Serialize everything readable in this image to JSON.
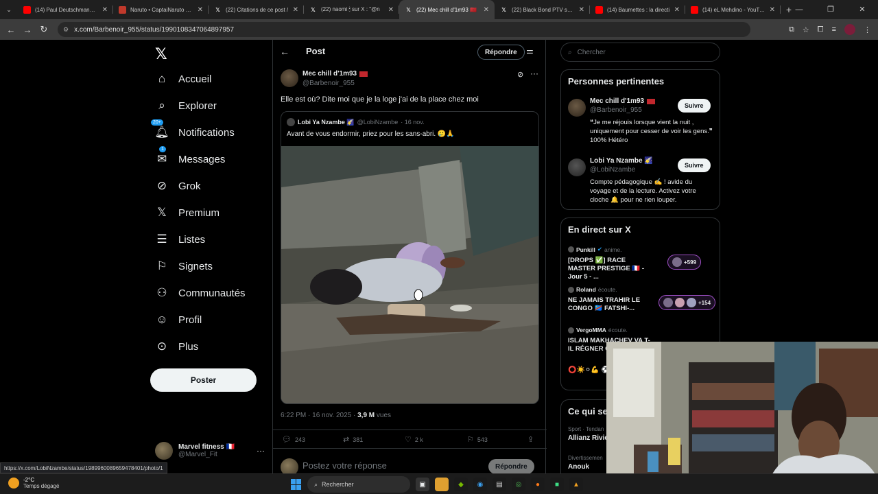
{
  "browser": {
    "tabs": [
      {
        "title": "(14) Paul Deutschmann : l",
        "favicon": "youtube-icon",
        "color": "#ff0000",
        "active": false
      },
      {
        "title": "Naruto • CaptaiNaruto », I",
        "favicon": "naruto-icon",
        "color": "#c0392b",
        "active": false
      },
      {
        "title": "(22) Citations de ce post /",
        "favicon": "x-icon",
        "color": "#ffffff",
        "active": false
      },
      {
        "title": "(22) naomi 🕯 sur X : \"@n",
        "favicon": "x-icon",
        "color": "#ffffff",
        "active": false
      },
      {
        "title": "(22) Mec chill d'1m93 🇲🇦",
        "favicon": "x-icon",
        "color": "#ffffff",
        "active": true
      },
      {
        "title": "(22) Black Bond PTV sur X",
        "favicon": "x-icon",
        "color": "#ffffff",
        "active": false
      },
      {
        "title": "(14) Baumettes : la directi",
        "favicon": "youtube-icon",
        "color": "#ff0000",
        "active": false
      },
      {
        "title": "(14) eL Mehdino - YouTub",
        "favicon": "youtube-icon",
        "color": "#ff0000",
        "active": false
      }
    ],
    "url": "x.com/Barbenoir_955/status/1990108347064897957",
    "status_url": "https://x.com/LobiNzambe/status/1989960089659478401/photo/1"
  },
  "nav": {
    "items": [
      {
        "label": "Accueil",
        "icon": "home-icon",
        "glyph": "⌂"
      },
      {
        "label": "Explorer",
        "icon": "search-icon",
        "glyph": "⌕"
      },
      {
        "label": "Notifications",
        "icon": "bell-icon",
        "glyph": "🔔︎",
        "badge": "20+"
      },
      {
        "label": "Messages",
        "icon": "mail-icon",
        "glyph": "✉",
        "badge": "1"
      },
      {
        "label": "Grok",
        "icon": "grok-icon",
        "glyph": "⊘"
      },
      {
        "label": "Premium",
        "icon": "x-premium-icon",
        "glyph": "𝕏"
      },
      {
        "label": "Listes",
        "icon": "list-icon",
        "glyph": "☰"
      },
      {
        "label": "Signets",
        "icon": "bookmark-icon",
        "glyph": "⚐"
      },
      {
        "label": "Communautés",
        "icon": "communities-icon",
        "glyph": "⚇"
      },
      {
        "label": "Profil",
        "icon": "profile-icon",
        "glyph": "☺"
      },
      {
        "label": "Plus",
        "icon": "more-circle-icon",
        "glyph": "⊙"
      }
    ],
    "post_button": "Poster",
    "account": {
      "name": "Marvel fitness 🇫🇷",
      "handle": "@Marvel_Fit"
    }
  },
  "post": {
    "header_title": "Post",
    "reply_button": "Répondre",
    "author_name": "Mec chill d'1m93",
    "author_handle": "@Barbenoir_955",
    "text": "Elle est où? Dite moi que je la loge j'ai de la place chez moi",
    "quote": {
      "name": "Lobi Ya Nzambe 🌠",
      "handle": "@LobiNzambe",
      "date": "· 16 nov.",
      "text": "Avant de vous endormir, priez pour les sans-abri. 🥲🙏"
    },
    "time": "6:22 PM · 16 nov. 2025 ·",
    "views_count": "3,9 M",
    "views_label": "vues",
    "stats": {
      "replies": "243",
      "reposts": "381",
      "likes": "2 k",
      "bookmarks": "543"
    },
    "reply_placeholder": "Postez votre réponse",
    "reply_submit": "Répondre"
  },
  "sidebar": {
    "search_placeholder": "Chercher",
    "relevant_title": "Personnes pertinentes",
    "people": [
      {
        "name": "Mec chill d'1m93",
        "handle": "@Barbenoir_955",
        "bio": "❝Je me réjouis lorsque vient la nuit , uniquement pour cesser de voir les gens.❞ 100% Hétéro",
        "follow": "Suivre"
      },
      {
        "name": "Lobi Ya Nzambe 🌠",
        "handle": "@LobiNzambe",
        "bio": "Compte pédagogique ✍️ ! avide du voyage et de la lecture. Activez votre cloche 🔔 pour ne rien louper.",
        "follow": "Suivre"
      }
    ],
    "live_title": "En direct sur X",
    "live": [
      {
        "host": "Punkill",
        "action": "anime.",
        "title": "[DROPS ✅] RACE MASTER PRESTIGE 🇫🇷 - Jour 5 - ...",
        "count": "+599"
      },
      {
        "host": "Roland",
        "action": "écoute.",
        "title": "NE JAMAIS TRAHIR LE CONGO 🇨🇩 FATSHI-...",
        "count": "+154"
      },
      {
        "host": "VergoMMA",
        "action": "écoute.",
        "title": "ISLAM MAKHACHEV VA T-IL RÉGNER C",
        "count": ""
      }
    ],
    "live_extra": "⭕☀️⚪💪 ⚽📖",
    "trends_title": "Ce qui se",
    "trends": [
      {
        "category": "Sport · Tendan",
        "name": "Allianz Rivie"
      },
      {
        "category": "Divertissemen",
        "name": "Anouk"
      }
    ]
  },
  "taskbar": {
    "temp": "-2°C",
    "weather": "Temps dégagé",
    "search": "Rechercher"
  }
}
